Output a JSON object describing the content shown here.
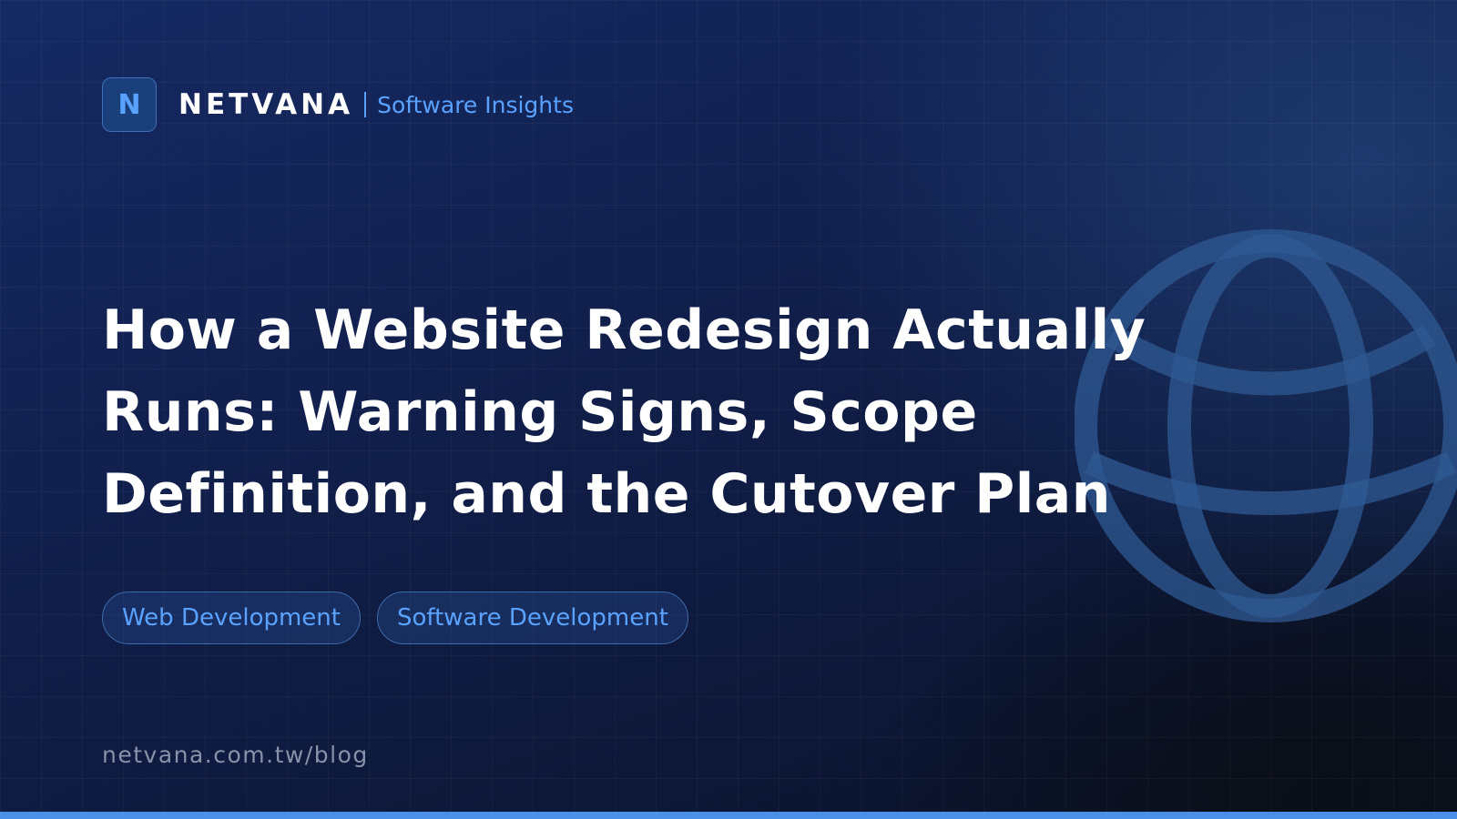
{
  "brand": {
    "logo_letter": "N",
    "name": "NETVANA",
    "tagline": "Software Insights"
  },
  "article": {
    "title_lines": [
      "How a Website Redesign Actually",
      "Runs: Warning Signs, Scope",
      "Definition, and the Cutover Plan"
    ]
  },
  "tags": [
    {
      "label": "Web Development"
    },
    {
      "label": "Software Development"
    }
  ],
  "footer": {
    "url": "netvana.com.tw/blog"
  },
  "decor": {
    "background_icon": "globe-icon"
  },
  "colors": {
    "accent": "#5aa2ff",
    "background_dark": "#0d1838",
    "background_light": "#152a63",
    "bottom_bar": "#4a8fe8"
  }
}
